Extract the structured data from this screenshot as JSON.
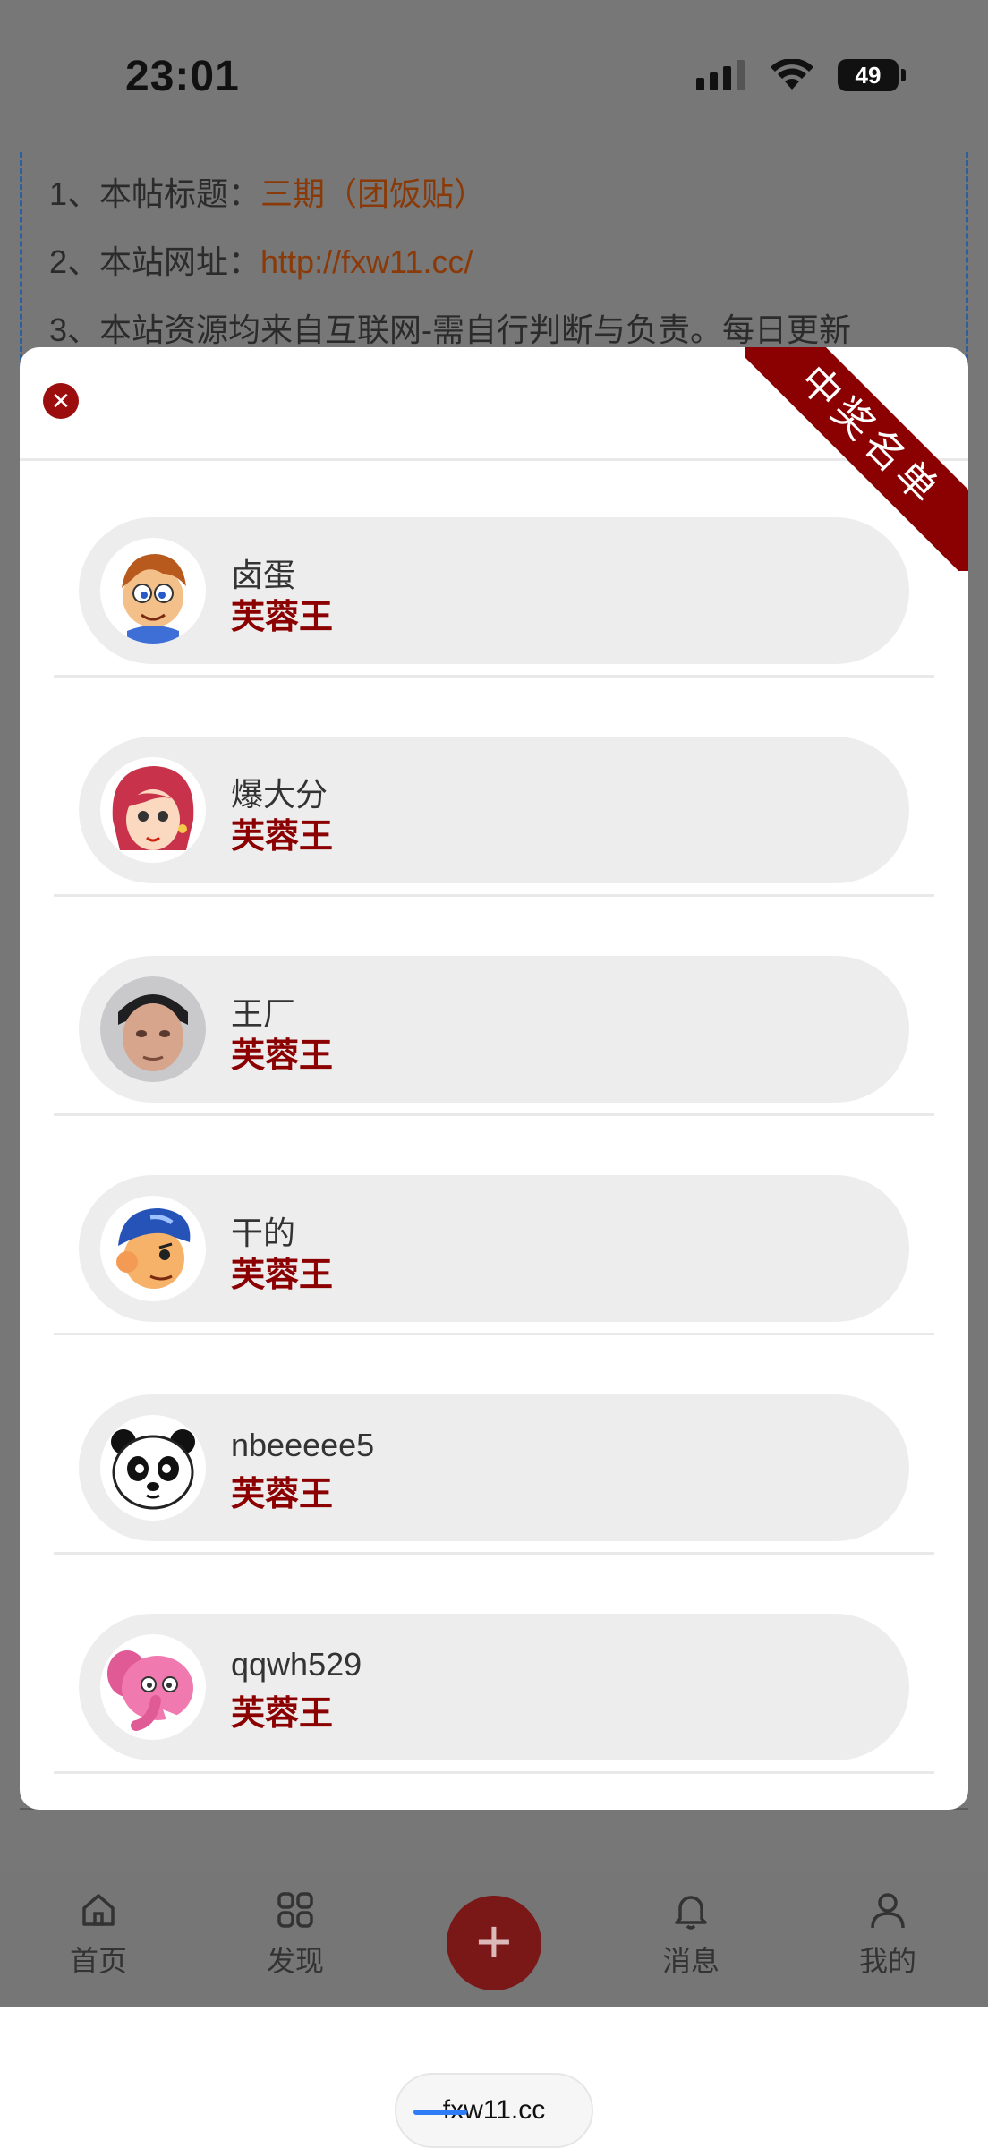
{
  "status_bar": {
    "time": "23:01",
    "battery": "49"
  },
  "background_post": {
    "line1_prefix": "1、本帖标题：",
    "line1_value": "三期（团饭贴）",
    "line2_prefix": "2、本站网址：",
    "line2_value": "http://fxw11.cc/",
    "line3": "3、本站资源均来自互联网-需自行判断与负责。每日更新"
  },
  "modal": {
    "ribbon_text": "中奖名单",
    "winners": [
      {
        "name": "卤蛋",
        "prize": "芙蓉王",
        "avatar_icon": "cartoon-boy-avatar"
      },
      {
        "name": "爆大分",
        "prize": "芙蓉王",
        "avatar_icon": "cartoon-girl-avatar"
      },
      {
        "name": "王厂",
        "prize": "芙蓉王",
        "avatar_icon": "photo-avatar"
      },
      {
        "name": "干的",
        "prize": "芙蓉王",
        "avatar_icon": "cartoon-cap-boy-avatar"
      },
      {
        "name": "nbeeeee5",
        "prize": "芙蓉王",
        "avatar_icon": "panda-avatar"
      },
      {
        "name": "qqwh529",
        "prize": "芙蓉王",
        "avatar_icon": "pink-elephant-avatar"
      }
    ]
  },
  "bottom_nav": {
    "items": [
      {
        "label": "首页",
        "icon": "home-icon"
      },
      {
        "label": "发现",
        "icon": "grid-icon"
      },
      {
        "label": "",
        "icon": "plus-icon"
      },
      {
        "label": "消息",
        "icon": "bell-icon"
      },
      {
        "label": "我的",
        "icon": "user-icon"
      }
    ]
  },
  "browser": {
    "url": "fxw11.cc"
  },
  "colors": {
    "accent": "#8b0000",
    "overlay": "#777777",
    "pill": "#ededed"
  }
}
